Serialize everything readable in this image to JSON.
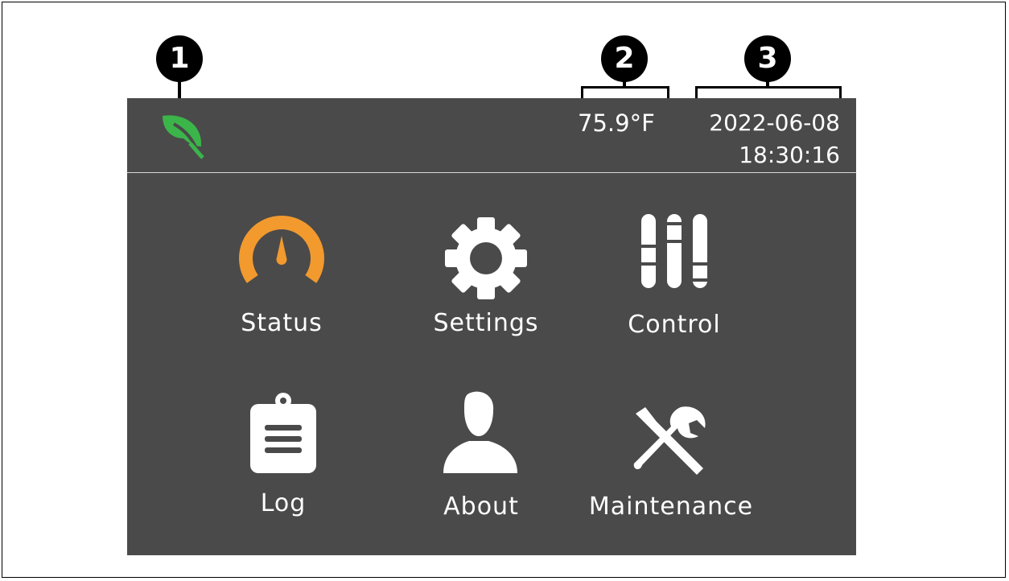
{
  "callouts": {
    "one": "1",
    "two": "2",
    "three": "3"
  },
  "header": {
    "temperature": "75.9°F",
    "date": "2022-06-08",
    "time": "18:30:16",
    "eco_icon": "leaf-icon"
  },
  "menu": {
    "status": {
      "label": "Status",
      "icon": "gauge-icon"
    },
    "settings": {
      "label": "Settings",
      "icon": "gear-icon"
    },
    "control": {
      "label": "Control",
      "icon": "sliders-icon"
    },
    "log": {
      "label": "Log",
      "icon": "clipboard-icon"
    },
    "about": {
      "label": "About",
      "icon": "person-icon"
    },
    "maintenance": {
      "label": "Maintenance",
      "icon": "tools-icon"
    }
  },
  "colors": {
    "screen_bg": "#4a4a4a",
    "accent_orange": "#f29a2e",
    "leaf_green": "#3bb54a",
    "text": "#ffffff"
  }
}
